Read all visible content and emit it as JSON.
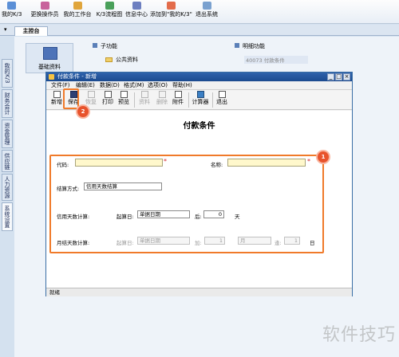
{
  "toolbar": {
    "items": [
      {
        "label": "我的K/3"
      },
      {
        "label": "更换操作员"
      },
      {
        "label": "我的工作台"
      },
      {
        "label": "K/3流程图"
      },
      {
        "label": "信息中心"
      },
      {
        "label": "添加到\"我的K/3\""
      },
      {
        "label": "退出系统"
      }
    ]
  },
  "tabbar": {
    "main_tab": "主控台"
  },
  "side_tabs": [
    "我的K/3",
    "财务会计",
    "资金管理",
    "供应链",
    "人力资源",
    "系统设置"
  ],
  "background": {
    "module_label": "基础资料",
    "subfunc_header": "子功能",
    "detail_header": "明细功能",
    "subfunc_item": "公共资料",
    "detail_item": "40073 付款条件"
  },
  "dialog": {
    "title": "付款条件 - 新增",
    "menu": [
      "文件(F)",
      "编辑(E)",
      "数据(D)",
      "格式(M)",
      "选项(O)",
      "帮助(H)"
    ],
    "tools": [
      {
        "label": "新增",
        "enabled": true
      },
      {
        "label": "保存",
        "enabled": true
      },
      {
        "label": "恢复",
        "enabled": false
      },
      {
        "label": "打印",
        "enabled": true
      },
      {
        "label": "预览",
        "enabled": true
      },
      {
        "label": "资料",
        "enabled": false
      },
      {
        "label": "删除",
        "enabled": false
      },
      {
        "label": "附件",
        "enabled": true
      },
      {
        "label": "计算器",
        "enabled": true
      },
      {
        "label": "退出",
        "enabled": true
      }
    ],
    "form_title": "付款条件",
    "fields": {
      "code_label": "代码:",
      "code_value": "",
      "name_label": "名称:",
      "name_value": "",
      "settle_label": "结算方式:",
      "settle_value": "信用天数结算",
      "credit_label": "信用天数计算:",
      "credit_start_label": "起算日:",
      "credit_start_value": "单据日期",
      "credit_after_label": "后:",
      "credit_days_value": "0",
      "credit_days_unit": "天",
      "monthly_label": "月结天数计算:",
      "monthly_start_label": "起算日:",
      "monthly_start_value": "单据日期",
      "monthly_add_label": "加:",
      "monthly_add_value": "1",
      "monthly_month_value": "月",
      "monthly_day_label": "逢:",
      "monthly_day_value": "1",
      "monthly_day_unit": "日"
    },
    "required_mark": "*",
    "status": "就绪"
  },
  "annotations": {
    "badge_1": "1",
    "badge_2": "2"
  },
  "watermark": "软件技巧",
  "colors": {
    "highlight": "#f07a2a",
    "badge": "#e8532c",
    "title_bar": "#1b4a8f"
  }
}
